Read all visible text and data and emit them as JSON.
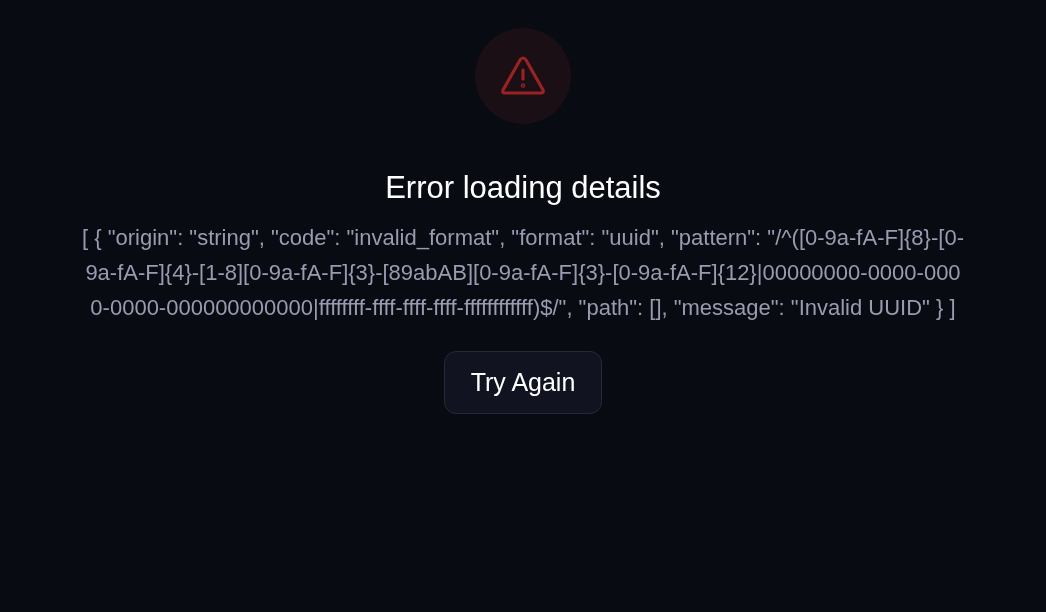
{
  "error": {
    "title": "Error loading details",
    "message": "[ { \"origin\": \"string\", \"code\": \"invalid_format\", \"format\": \"uuid\", \"pattern\": \"/^([0-9a-fA-F]{8}-[0-9a-fA-F]{4}-[1-8][0-9a-fA-F]{3}-[89abAB][0-9a-fA-F]{3}-[0-9a-fA-F]{12}|00000000-0000-0000-0000-000000000000|ffffffff-ffff-ffff-ffff-ffffffffffff)$/\", \"path\": [], \"message\": \"Invalid UUID\" } ]",
    "button": "Try Again"
  }
}
